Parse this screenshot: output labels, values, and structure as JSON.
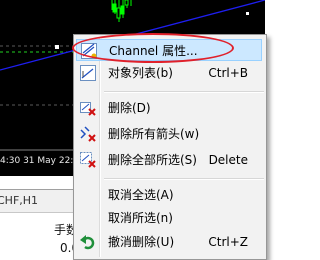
{
  "chart": {
    "time_labels": "4:30  31 May 22:3"
  },
  "panel": {
    "tab_label": "CHF,H1",
    "column_header": "手数",
    "cell_value": "0.0"
  },
  "menu": {
    "items": [
      {
        "label": "Channel 属性...",
        "shortcut": "",
        "icon": "channel-properties-icon"
      },
      {
        "label": "对象列表(b)",
        "shortcut": "Ctrl+B",
        "icon": "object-list-icon"
      },
      {
        "label": "删除(D)",
        "shortcut": "",
        "icon": "delete-icon"
      },
      {
        "label": "删除所有箭头(w)",
        "shortcut": "",
        "icon": "delete-arrows-icon"
      },
      {
        "label": "删除全部所选(S)",
        "shortcut": "Delete",
        "icon": "delete-selected-icon"
      },
      {
        "label": "取消全选(A)",
        "shortcut": "",
        "icon": ""
      },
      {
        "label": "取消所选(n)",
        "shortcut": "",
        "icon": ""
      },
      {
        "label": "撤消删除(U)",
        "shortcut": "Ctrl+Z",
        "icon": "undo-icon"
      }
    ]
  },
  "colors": {
    "menu_highlight": "#cce8ff",
    "annotation": "#e0202a",
    "chart_background": "#000000",
    "candles": "#00ff00",
    "trendline": "#1e1ef0"
  }
}
